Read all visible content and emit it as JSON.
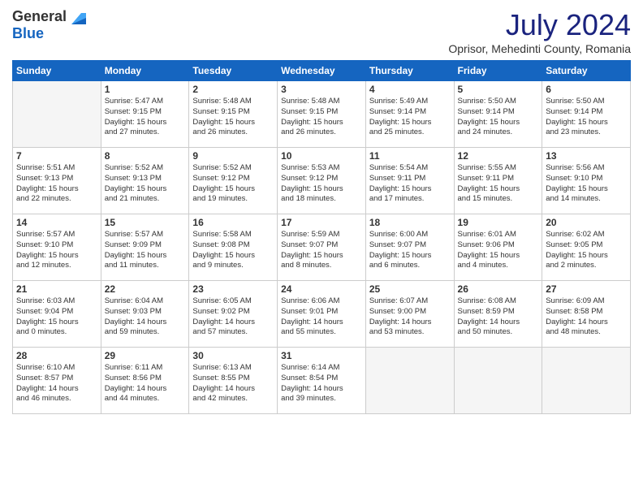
{
  "logo": {
    "general": "General",
    "blue": "Blue"
  },
  "title": "July 2024",
  "location": "Oprisor, Mehedinti County, Romania",
  "weekdays": [
    "Sunday",
    "Monday",
    "Tuesday",
    "Wednesday",
    "Thursday",
    "Friday",
    "Saturday"
  ],
  "weeks": [
    [
      {
        "day": "",
        "sunrise": "",
        "sunset": "",
        "daylight": ""
      },
      {
        "day": "1",
        "sunrise": "Sunrise: 5:47 AM",
        "sunset": "Sunset: 9:15 PM",
        "daylight": "Daylight: 15 hours",
        "extra": "and 27 minutes."
      },
      {
        "day": "2",
        "sunrise": "Sunrise: 5:48 AM",
        "sunset": "Sunset: 9:15 PM",
        "daylight": "Daylight: 15 hours",
        "extra": "and 26 minutes."
      },
      {
        "day": "3",
        "sunrise": "Sunrise: 5:48 AM",
        "sunset": "Sunset: 9:15 PM",
        "daylight": "Daylight: 15 hours",
        "extra": "and 26 minutes."
      },
      {
        "day": "4",
        "sunrise": "Sunrise: 5:49 AM",
        "sunset": "Sunset: 9:14 PM",
        "daylight": "Daylight: 15 hours",
        "extra": "and 25 minutes."
      },
      {
        "day": "5",
        "sunrise": "Sunrise: 5:50 AM",
        "sunset": "Sunset: 9:14 PM",
        "daylight": "Daylight: 15 hours",
        "extra": "and 24 minutes."
      },
      {
        "day": "6",
        "sunrise": "Sunrise: 5:50 AM",
        "sunset": "Sunset: 9:14 PM",
        "daylight": "Daylight: 15 hours",
        "extra": "and 23 minutes."
      }
    ],
    [
      {
        "day": "7",
        "sunrise": "Sunrise: 5:51 AM",
        "sunset": "Sunset: 9:13 PM",
        "daylight": "Daylight: 15 hours",
        "extra": "and 22 minutes."
      },
      {
        "day": "8",
        "sunrise": "Sunrise: 5:52 AM",
        "sunset": "Sunset: 9:13 PM",
        "daylight": "Daylight: 15 hours",
        "extra": "and 21 minutes."
      },
      {
        "day": "9",
        "sunrise": "Sunrise: 5:52 AM",
        "sunset": "Sunset: 9:12 PM",
        "daylight": "Daylight: 15 hours",
        "extra": "and 19 minutes."
      },
      {
        "day": "10",
        "sunrise": "Sunrise: 5:53 AM",
        "sunset": "Sunset: 9:12 PM",
        "daylight": "Daylight: 15 hours",
        "extra": "and 18 minutes."
      },
      {
        "day": "11",
        "sunrise": "Sunrise: 5:54 AM",
        "sunset": "Sunset: 9:11 PM",
        "daylight": "Daylight: 15 hours",
        "extra": "and 17 minutes."
      },
      {
        "day": "12",
        "sunrise": "Sunrise: 5:55 AM",
        "sunset": "Sunset: 9:11 PM",
        "daylight": "Daylight: 15 hours",
        "extra": "and 15 minutes."
      },
      {
        "day": "13",
        "sunrise": "Sunrise: 5:56 AM",
        "sunset": "Sunset: 9:10 PM",
        "daylight": "Daylight: 15 hours",
        "extra": "and 14 minutes."
      }
    ],
    [
      {
        "day": "14",
        "sunrise": "Sunrise: 5:57 AM",
        "sunset": "Sunset: 9:10 PM",
        "daylight": "Daylight: 15 hours",
        "extra": "and 12 minutes."
      },
      {
        "day": "15",
        "sunrise": "Sunrise: 5:57 AM",
        "sunset": "Sunset: 9:09 PM",
        "daylight": "Daylight: 15 hours",
        "extra": "and 11 minutes."
      },
      {
        "day": "16",
        "sunrise": "Sunrise: 5:58 AM",
        "sunset": "Sunset: 9:08 PM",
        "daylight": "Daylight: 15 hours",
        "extra": "and 9 minutes."
      },
      {
        "day": "17",
        "sunrise": "Sunrise: 5:59 AM",
        "sunset": "Sunset: 9:07 PM",
        "daylight": "Daylight: 15 hours",
        "extra": "and 8 minutes."
      },
      {
        "day": "18",
        "sunrise": "Sunrise: 6:00 AM",
        "sunset": "Sunset: 9:07 PM",
        "daylight": "Daylight: 15 hours",
        "extra": "and 6 minutes."
      },
      {
        "day": "19",
        "sunrise": "Sunrise: 6:01 AM",
        "sunset": "Sunset: 9:06 PM",
        "daylight": "Daylight: 15 hours",
        "extra": "and 4 minutes."
      },
      {
        "day": "20",
        "sunrise": "Sunrise: 6:02 AM",
        "sunset": "Sunset: 9:05 PM",
        "daylight": "Daylight: 15 hours",
        "extra": "and 2 minutes."
      }
    ],
    [
      {
        "day": "21",
        "sunrise": "Sunrise: 6:03 AM",
        "sunset": "Sunset: 9:04 PM",
        "daylight": "Daylight: 15 hours",
        "extra": "and 0 minutes."
      },
      {
        "day": "22",
        "sunrise": "Sunrise: 6:04 AM",
        "sunset": "Sunset: 9:03 PM",
        "daylight": "Daylight: 14 hours",
        "extra": "and 59 minutes."
      },
      {
        "day": "23",
        "sunrise": "Sunrise: 6:05 AM",
        "sunset": "Sunset: 9:02 PM",
        "daylight": "Daylight: 14 hours",
        "extra": "and 57 minutes."
      },
      {
        "day": "24",
        "sunrise": "Sunrise: 6:06 AM",
        "sunset": "Sunset: 9:01 PM",
        "daylight": "Daylight: 14 hours",
        "extra": "and 55 minutes."
      },
      {
        "day": "25",
        "sunrise": "Sunrise: 6:07 AM",
        "sunset": "Sunset: 9:00 PM",
        "daylight": "Daylight: 14 hours",
        "extra": "and 53 minutes."
      },
      {
        "day": "26",
        "sunrise": "Sunrise: 6:08 AM",
        "sunset": "Sunset: 8:59 PM",
        "daylight": "Daylight: 14 hours",
        "extra": "and 50 minutes."
      },
      {
        "day": "27",
        "sunrise": "Sunrise: 6:09 AM",
        "sunset": "Sunset: 8:58 PM",
        "daylight": "Daylight: 14 hours",
        "extra": "and 48 minutes."
      }
    ],
    [
      {
        "day": "28",
        "sunrise": "Sunrise: 6:10 AM",
        "sunset": "Sunset: 8:57 PM",
        "daylight": "Daylight: 14 hours",
        "extra": "and 46 minutes."
      },
      {
        "day": "29",
        "sunrise": "Sunrise: 6:11 AM",
        "sunset": "Sunset: 8:56 PM",
        "daylight": "Daylight: 14 hours",
        "extra": "and 44 minutes."
      },
      {
        "day": "30",
        "sunrise": "Sunrise: 6:13 AM",
        "sunset": "Sunset: 8:55 PM",
        "daylight": "Daylight: 14 hours",
        "extra": "and 42 minutes."
      },
      {
        "day": "31",
        "sunrise": "Sunrise: 6:14 AM",
        "sunset": "Sunset: 8:54 PM",
        "daylight": "Daylight: 14 hours",
        "extra": "and 39 minutes."
      },
      {
        "day": "",
        "sunrise": "",
        "sunset": "",
        "daylight": ""
      },
      {
        "day": "",
        "sunrise": "",
        "sunset": "",
        "daylight": ""
      },
      {
        "day": "",
        "sunrise": "",
        "sunset": "",
        "daylight": ""
      }
    ]
  ]
}
